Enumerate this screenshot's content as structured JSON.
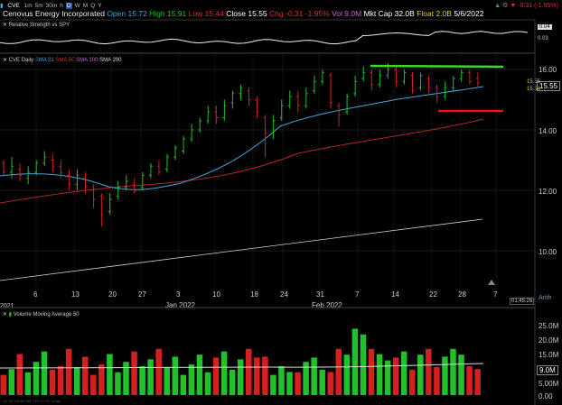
{
  "header": {
    "ticker": "CVE",
    "company": "Cenovus Energy Incorporated",
    "open_label": "Open",
    "open": "15.72",
    "high_label": "High",
    "high": "15.91",
    "low_label": "Low",
    "low": "15.44",
    "close_label": "Close",
    "close": "15.55",
    "chg_label": "Chg",
    "chg": "-0.31",
    "chg_pct": "-1.95%",
    "vol_label": "Vol",
    "vol": "9.0M",
    "mktcap_label": "Mkt Cap",
    "mktcap": "32.0B",
    "float_label": "Float",
    "float": "2.0B",
    "date": "5/6/2022",
    "right_change": "-0.31 (-1.95%)"
  },
  "toolbar": {
    "items": [
      "1m",
      "5m",
      "30m",
      "h",
      "D",
      "W",
      "M",
      "Q",
      "Y"
    ],
    "active": "D"
  },
  "rs_panel": {
    "label": "Relative Strength vs SPY",
    "ticks": [
      "0.04",
      "0.03"
    ]
  },
  "price_panel": {
    "legend": [
      "CVE Daily",
      "SMA 21",
      "SMA 50",
      "SMA 100",
      "SMA 200"
    ],
    "legend_colors": [
      "#cccccc",
      "#3fa9e0",
      "#e03030",
      "#cc66cc",
      "#dddddd"
    ],
    "y_ticks": [
      "16.00",
      "14.00",
      "12.00",
      "10.00"
    ],
    "last_price": "15.55",
    "tag_top": "15.55",
    "tag_bottom": "15.54",
    "x_ticks": [
      "6",
      "13",
      "20",
      "27",
      "3",
      "10",
      "18",
      "24",
      "31",
      "7",
      "14",
      "22",
      "28",
      "7"
    ],
    "month_labels": [
      "2021",
      "Jan 2022",
      "Feb 2022"
    ],
    "time_label": "01:45:26",
    "scale_mode": "Arith",
    "resistance_color": "#33dd22",
    "support_color": "#ee1111"
  },
  "volume_panel": {
    "legend": [
      "Volume",
      "Moving Average 50"
    ],
    "y_ticks": [
      "25.0M",
      "20.0M",
      "15.0M",
      "10.0M",
      "5.00M",
      "0.00"
    ],
    "last_volume": "9.0M",
    "bottom_range": "1D 5D 1M 3M 6M YTD 1Y 5Y Today"
  },
  "colors": {
    "up": "#22c02a",
    "down": "#d42020",
    "sma21": "#3fa9e0",
    "sma50": "#b02525",
    "sma200": "#d0d0d0"
  }
}
